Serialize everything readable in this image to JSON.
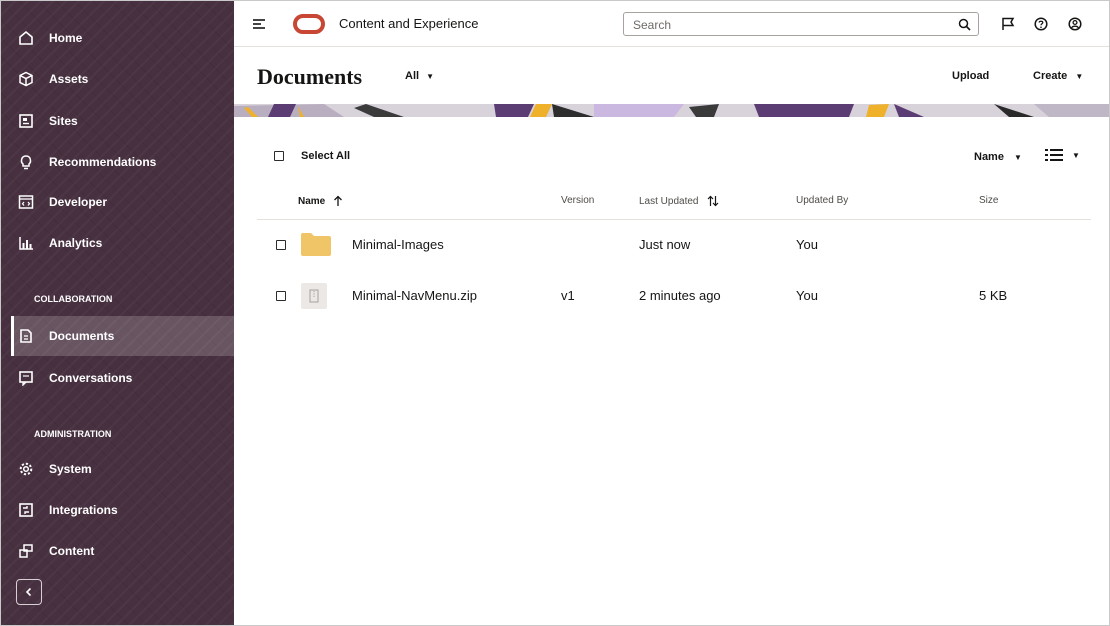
{
  "sidebar": {
    "nav": [
      {
        "label": "Home",
        "icon": "home-icon"
      },
      {
        "label": "Assets",
        "icon": "cube-icon"
      },
      {
        "label": "Sites",
        "icon": "sites-icon"
      },
      {
        "label": "Recommendations",
        "icon": "lightbulb-icon"
      },
      {
        "label": "Developer",
        "icon": "code-icon"
      },
      {
        "label": "Analytics",
        "icon": "analytics-icon"
      }
    ],
    "collaboration_label": "COLLABORATION",
    "collaboration": [
      {
        "label": "Documents",
        "icon": "documents-icon",
        "active": true
      },
      {
        "label": "Conversations",
        "icon": "conversations-icon"
      }
    ],
    "administration_label": "ADMINISTRATION",
    "administration": [
      {
        "label": "System",
        "icon": "gear-icon"
      },
      {
        "label": "Integrations",
        "icon": "integrations-icon"
      },
      {
        "label": "Content",
        "icon": "content-icon"
      }
    ],
    "collapse_icon": "chevron-left-icon"
  },
  "header": {
    "app_title": "Content and Experience",
    "search_placeholder": "Search",
    "icons": [
      "search-icon",
      "flag-icon",
      "help-icon",
      "user-icon"
    ]
  },
  "page": {
    "title": "Documents",
    "filter": "All",
    "upload": "Upload",
    "create": "Create"
  },
  "toolbar": {
    "select_all": "Select All",
    "sort_by": "Name"
  },
  "table": {
    "columns": [
      "Name",
      "Version",
      "Last Updated",
      "Updated By",
      "Size"
    ],
    "rows": [
      {
        "name": "Minimal-Images",
        "type": "folder",
        "version": "",
        "last_updated": "Just now",
        "updated_by": "You",
        "size": ""
      },
      {
        "name": "Minimal-NavMenu.zip",
        "type": "zip",
        "version": "v1",
        "last_updated": "2 minutes ago",
        "updated_by": "You",
        "size": "5 KB"
      }
    ]
  },
  "colors": {
    "sidebar_bg": "#47303f",
    "oracle_red": "#c74634",
    "folder": "#f0c567"
  }
}
